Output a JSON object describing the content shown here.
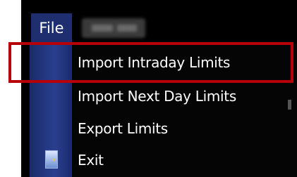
{
  "menubar": {
    "file_label": "File"
  },
  "file_menu": {
    "items": [
      {
        "label": "Import Intraday Limits",
        "highlighted": true
      },
      {
        "label": "Import Next Day Limits"
      },
      {
        "label": "Export Limits"
      },
      {
        "label": "Exit",
        "icon": "door-exit-icon"
      }
    ]
  },
  "colors": {
    "menu_background": "#050505",
    "icon_gutter": "#2b3f8f",
    "file_menu_selected": "#1e2e6e",
    "highlight_border": "#b80008",
    "menu_text": "#ffffff"
  }
}
